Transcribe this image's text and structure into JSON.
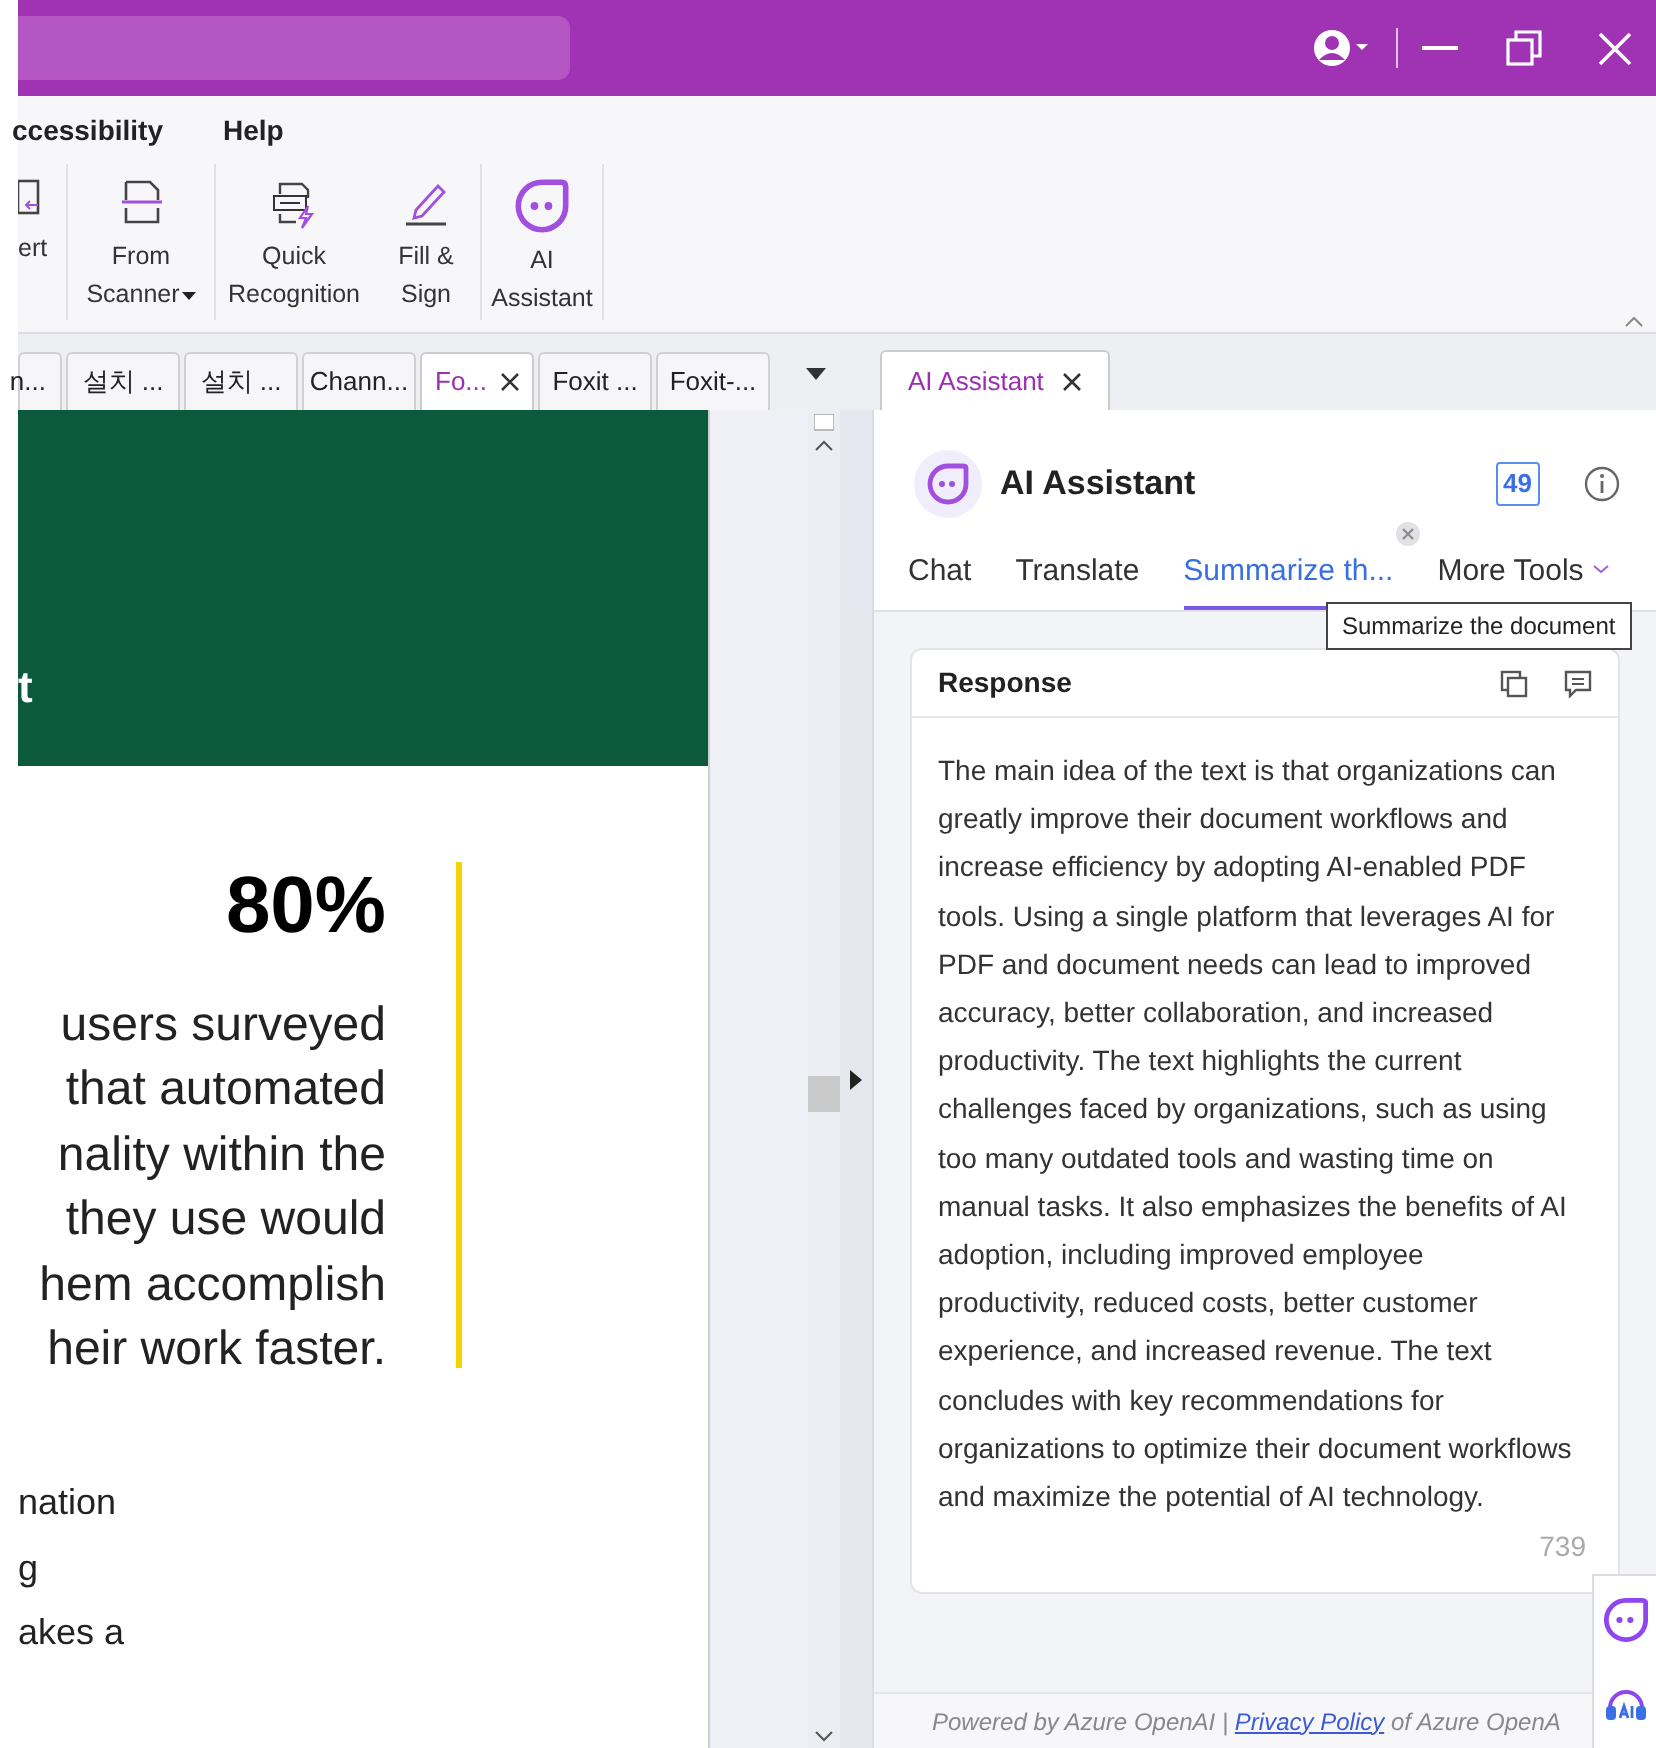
{
  "menu": [
    {
      "label": "ccessibility"
    },
    {
      "label": "Help"
    }
  ],
  "ribbon": [
    {
      "kind": "convert",
      "lines": [
        "ert"
      ],
      "dropdown": false
    },
    {
      "kind": "scanner",
      "lines": [
        "From",
        "Scanner"
      ],
      "dropdown": true
    },
    {
      "kind": "ocr",
      "lines": [
        "Quick",
        "Recognition"
      ],
      "dropdown": false
    },
    {
      "kind": "sign",
      "lines": [
        "Fill &",
        "Sign"
      ],
      "dropdown": false
    },
    {
      "kind": "ai",
      "lines": [
        "AI",
        "Assistant"
      ],
      "dropdown": false
    }
  ],
  "doc_tabs": [
    {
      "label": "n...",
      "selected": false
    },
    {
      "label": "설치 ...",
      "selected": false
    },
    {
      "label": "설치 ...",
      "selected": false
    },
    {
      "label": "Chann...",
      "selected": false
    },
    {
      "label": "Fo...",
      "selected": true
    },
    {
      "label": "Foxit ...",
      "selected": false
    },
    {
      "label": "Foxit-...",
      "selected": false
    }
  ],
  "panel_tab": {
    "label": "AI Assistant",
    "selected": true
  },
  "document": {
    "banner_text": "t",
    "stat": "80%",
    "quote_lines": [
      "users surveyed",
      "that automated",
      "nality within the",
      "they use would",
      "hem accomplish",
      "heir work faster."
    ],
    "body_lines": [
      "nation",
      "g",
      "akes a"
    ]
  },
  "ai": {
    "title": "AI Assistant",
    "credits": "49",
    "tabs": [
      {
        "label": "Chat",
        "selected": false
      },
      {
        "label": "Translate",
        "selected": false
      },
      {
        "label": "Summarize th...",
        "selected": true
      },
      {
        "label": "More Tools",
        "selected": false
      }
    ],
    "tooltip": "Summarize the document",
    "response": {
      "heading": "Response",
      "text": "The main idea of the text is that organizations can greatly improve their document workflows and increase efficiency by adopting AI-enabled PDF tools. Using a single platform that leverages AI for PDF and document needs can lead to improved accuracy, better collaboration, and increased productivity. The text highlights the current challenges faced by organizations, such as using too many outdated tools and wasting time on manual tasks. It also emphasizes the benefits of AI adoption, including improved employee productivity, reduced costs, better customer experience, and increased revenue. The text concludes with key recommendations for organizations to optimize their document workflows and maximize the potential of AI technology.",
      "count": "739"
    },
    "footer": {
      "prefix": "Powered by Azure OpenAI | ",
      "link": "Privacy Policy",
      "suffix": " of Azure OpenA"
    }
  }
}
